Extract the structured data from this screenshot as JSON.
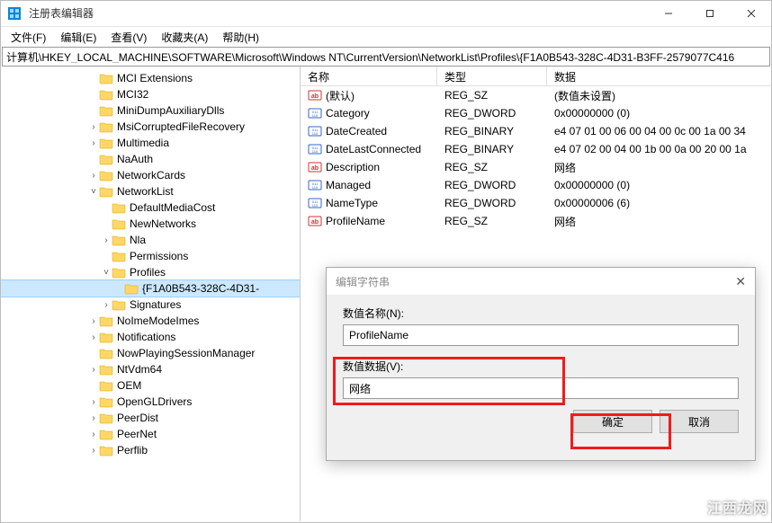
{
  "window": {
    "title": "注册表编辑器"
  },
  "menu": {
    "file": "文件(F)",
    "edit": "编辑(E)",
    "view": "查看(V)",
    "favorites": "收藏夹(A)",
    "help": "帮助(H)"
  },
  "address": "计算机\\HKEY_LOCAL_MACHINE\\SOFTWARE\\Microsoft\\Windows NT\\CurrentVersion\\NetworkList\\Profiles\\{F1A0B543-328C-4D31-B3FF-2579077C416",
  "tree": [
    {
      "indent": 7,
      "chev": "",
      "label": "MCI Extensions"
    },
    {
      "indent": 7,
      "chev": "",
      "label": "MCI32"
    },
    {
      "indent": 7,
      "chev": "",
      "label": "MiniDumpAuxiliaryDlls"
    },
    {
      "indent": 7,
      "chev": "›",
      "label": "MsiCorruptedFileRecovery"
    },
    {
      "indent": 7,
      "chev": "›",
      "label": "Multimedia"
    },
    {
      "indent": 7,
      "chev": "",
      "label": "NaAuth"
    },
    {
      "indent": 7,
      "chev": "›",
      "label": "NetworkCards"
    },
    {
      "indent": 7,
      "chev": "˅",
      "label": "NetworkList"
    },
    {
      "indent": 8,
      "chev": "",
      "label": "DefaultMediaCost"
    },
    {
      "indent": 8,
      "chev": "",
      "label": "NewNetworks"
    },
    {
      "indent": 8,
      "chev": "›",
      "label": "Nla"
    },
    {
      "indent": 8,
      "chev": "",
      "label": "Permissions"
    },
    {
      "indent": 8,
      "chev": "˅",
      "label": "Profiles"
    },
    {
      "indent": 9,
      "chev": "",
      "label": "{F1A0B543-328C-4D31-",
      "selected": true
    },
    {
      "indent": 8,
      "chev": "›",
      "label": "Signatures"
    },
    {
      "indent": 7,
      "chev": "›",
      "label": "NoImeModeImes"
    },
    {
      "indent": 7,
      "chev": "›",
      "label": "Notifications"
    },
    {
      "indent": 7,
      "chev": "",
      "label": "NowPlayingSessionManager"
    },
    {
      "indent": 7,
      "chev": "›",
      "label": "NtVdm64"
    },
    {
      "indent": 7,
      "chev": "",
      "label": "OEM"
    },
    {
      "indent": 7,
      "chev": "›",
      "label": "OpenGLDrivers"
    },
    {
      "indent": 7,
      "chev": "›",
      "label": "PeerDist"
    },
    {
      "indent": 7,
      "chev": "›",
      "label": "PeerNet"
    },
    {
      "indent": 7,
      "chev": "›",
      "label": "Perflib"
    }
  ],
  "listHeader": {
    "name": "名称",
    "type": "类型",
    "data": "数据"
  },
  "values": [
    {
      "icon": "str",
      "name": "(默认)",
      "type": "REG_SZ",
      "data": "(数值未设置)"
    },
    {
      "icon": "bin",
      "name": "Category",
      "type": "REG_DWORD",
      "data": "0x00000000 (0)"
    },
    {
      "icon": "bin",
      "name": "DateCreated",
      "type": "REG_BINARY",
      "data": "e4 07 01 00 06 00 04 00 0c 00 1a 00 34"
    },
    {
      "icon": "bin",
      "name": "DateLastConnected",
      "type": "REG_BINARY",
      "data": "e4 07 02 00 04 00 1b 00 0a 00 20 00 1a"
    },
    {
      "icon": "str",
      "name": "Description",
      "type": "REG_SZ",
      "data": "网络"
    },
    {
      "icon": "bin",
      "name": "Managed",
      "type": "REG_DWORD",
      "data": "0x00000000 (0)"
    },
    {
      "icon": "bin",
      "name": "NameType",
      "type": "REG_DWORD",
      "data": "0x00000006 (6)"
    },
    {
      "icon": "str",
      "name": "ProfileName",
      "type": "REG_SZ",
      "data": "网络"
    }
  ],
  "dialog": {
    "title": "编辑字符串",
    "nameLabel": "数值名称(N):",
    "nameValue": "ProfileName",
    "dataLabel": "数值数据(V):",
    "dataValue": "网络",
    "ok": "确定",
    "cancel": "取消"
  },
  "watermark": "江西龙网"
}
